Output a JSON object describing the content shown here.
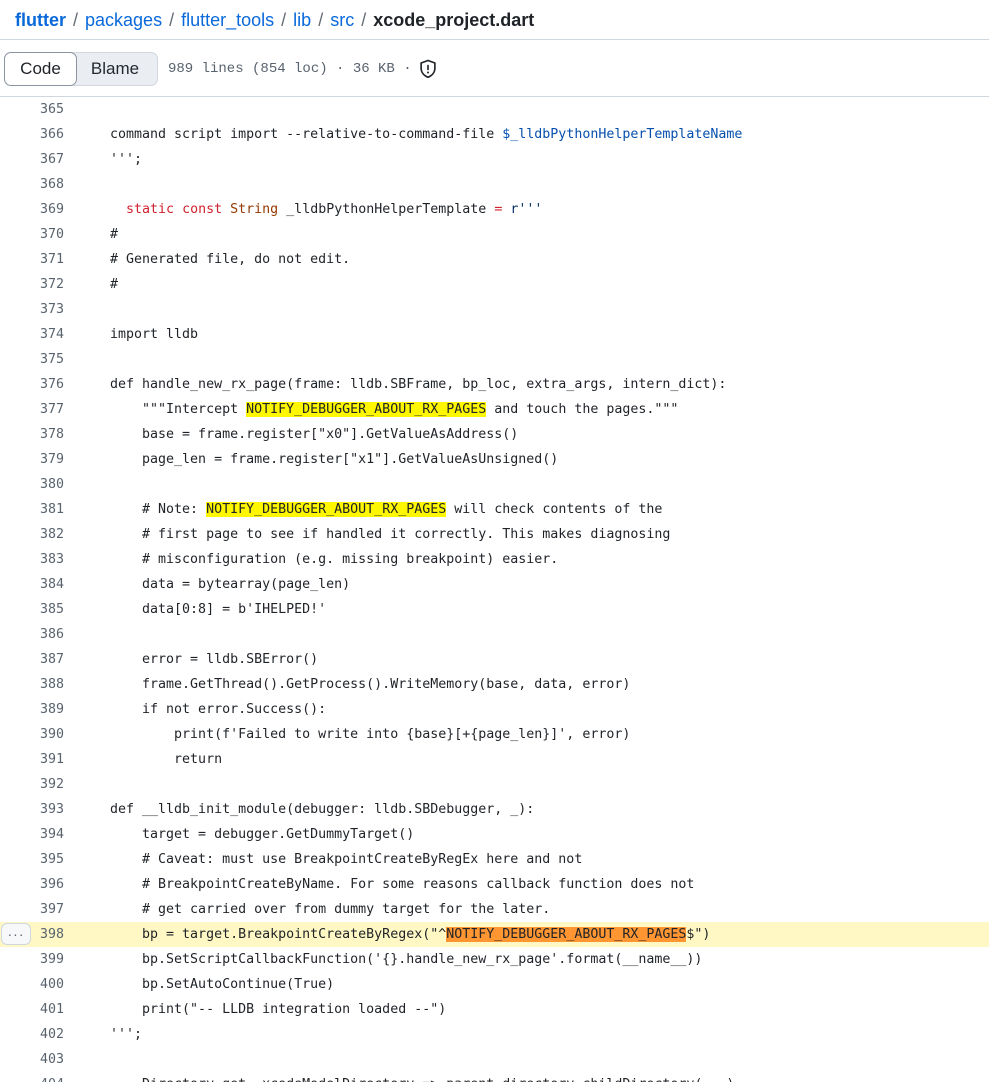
{
  "breadcrumb": {
    "root": "flutter",
    "parts": [
      "packages",
      "flutter_tools",
      "lib",
      "src"
    ],
    "separator": "/",
    "file": "xcode_project.dart"
  },
  "toolbar": {
    "code_tab": "Code",
    "blame_tab": "Blame",
    "meta": "989 lines (854 loc) · 36 KB ·",
    "shield_icon": "shield-icon"
  },
  "more_button": "···",
  "code": {
    "lines": [
      {
        "n": "365",
        "t": ""
      },
      {
        "n": "366",
        "t": "command script import --relative-to-command-file $_lldbPythonHelperTemplateName"
      },
      {
        "n": "367",
        "t": "''';"
      },
      {
        "n": "368",
        "t": ""
      },
      {
        "n": "369",
        "t": "  static const String _lldbPythonHelperTemplate = r'''"
      },
      {
        "n": "370",
        "t": "#"
      },
      {
        "n": "371",
        "t": "# Generated file, do not edit."
      },
      {
        "n": "372",
        "t": "#"
      },
      {
        "n": "373",
        "t": ""
      },
      {
        "n": "374",
        "t": "import lldb"
      },
      {
        "n": "375",
        "t": ""
      },
      {
        "n": "376",
        "t": "def handle_new_rx_page(frame: lldb.SBFrame, bp_loc, extra_args, intern_dict):"
      },
      {
        "n": "377",
        "t": "    \"\"\"Intercept NOTIFY_DEBUGGER_ABOUT_RX_PAGES and touch the pages.\"\"\""
      },
      {
        "n": "378",
        "t": "    base = frame.register[\"x0\"].GetValueAsAddress()"
      },
      {
        "n": "379",
        "t": "    page_len = frame.register[\"x1\"].GetValueAsUnsigned()"
      },
      {
        "n": "380",
        "t": ""
      },
      {
        "n": "381",
        "t": "    # Note: NOTIFY_DEBUGGER_ABOUT_RX_PAGES will check contents of the"
      },
      {
        "n": "382",
        "t": "    # first page to see if handled it correctly. This makes diagnosing"
      },
      {
        "n": "383",
        "t": "    # misconfiguration (e.g. missing breakpoint) easier."
      },
      {
        "n": "384",
        "t": "    data = bytearray(page_len)"
      },
      {
        "n": "385",
        "t": "    data[0:8] = b'IHELPED!'"
      },
      {
        "n": "386",
        "t": ""
      },
      {
        "n": "387",
        "t": "    error = lldb.SBError()"
      },
      {
        "n": "388",
        "t": "    frame.GetThread().GetProcess().WriteMemory(base, data, error)"
      },
      {
        "n": "389",
        "t": "    if not error.Success():"
      },
      {
        "n": "390",
        "t": "        print(f'Failed to write into {base}[+{page_len}]', error)"
      },
      {
        "n": "391",
        "t": "        return"
      },
      {
        "n": "392",
        "t": ""
      },
      {
        "n": "393",
        "t": "def __lldb_init_module(debugger: lldb.SBDebugger, _):"
      },
      {
        "n": "394",
        "t": "    target = debugger.GetDummyTarget()"
      },
      {
        "n": "395",
        "t": "    # Caveat: must use BreakpointCreateByRegEx here and not"
      },
      {
        "n": "396",
        "t": "    # BreakpointCreateByName. For some reasons callback function does not"
      },
      {
        "n": "397",
        "t": "    # get carried over from dummy target for the later."
      },
      {
        "n": "398",
        "t": "    bp = target.BreakpointCreateByRegex(\"^NOTIFY_DEBUGGER_ABOUT_RX_PAGES$\")"
      },
      {
        "n": "399",
        "t": "    bp.SetScriptCallbackFunction('{}.handle_new_rx_page'.format(__name__))"
      },
      {
        "n": "400",
        "t": "    bp.SetAutoContinue(True)"
      },
      {
        "n": "401",
        "t": "    print(\"-- LLDB integration loaded --\")"
      },
      {
        "n": "402",
        "t": "''';"
      },
      {
        "n": "403",
        "t": ""
      }
    ],
    "partial_line": {
      "n": "404",
      "t": "    Directory get _xcodeModelDirectory => parent.directory.childDirectory(...)"
    }
  },
  "colors": {
    "search_highlight": "#fff700",
    "active_search_highlight": "#ff9632",
    "selected_line": "#fff8c5",
    "link": "#0969da",
    "keyword": "#cf222e",
    "entity": "#0550ae"
  }
}
